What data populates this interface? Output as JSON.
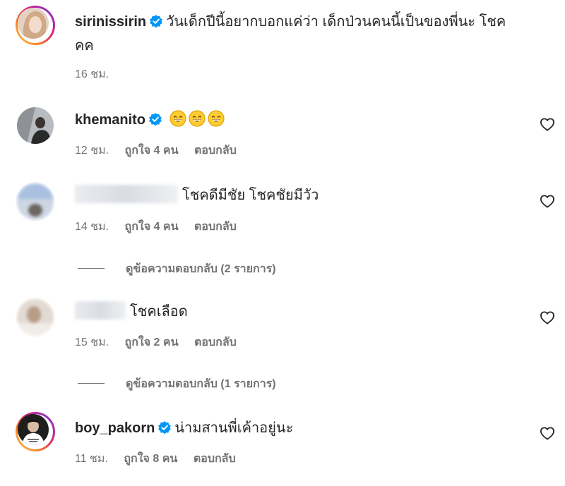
{
  "comments": [
    {
      "username": "sirinissirin",
      "verified": true,
      "text": "วันเด็กปีนี้อยากบอกแค่ว่า เด็กป่วนคนนี้เป็นของพี่นะ โชค",
      "text_cont": "คค",
      "time": "16 ชม."
    },
    {
      "username": "khemanito",
      "verified": true,
      "emojis": [
        "grinning-face-smiling-eyes",
        "grinning-face-smiling-eyes",
        "grinning-face-smiling-eyes"
      ],
      "time": "12 ชม.",
      "likes": "ถูกใจ 4 คน",
      "reply": "ตอบกลับ"
    },
    {
      "username": "",
      "text": "โชคดีมีชัย โชคชัยมีวัว",
      "time": "14 ชม.",
      "likes": "ถูกใจ 4 คน",
      "reply": "ตอบกลับ",
      "view_replies": "ดูข้อความตอบกลับ (2 รายการ)"
    },
    {
      "username": "",
      "text": "โชคเลือด",
      "time": "15 ชม.",
      "likes": "ถูกใจ 2 คน",
      "reply": "ตอบกลับ",
      "view_replies": "ดูข้อความตอบกลับ (1 รายการ)"
    },
    {
      "username": "boy_pakorn",
      "verified": true,
      "text": "น่ามสานพี่เค้าอยู่นะ",
      "time": "11 ชม.",
      "likes": "ถูกใจ 8 คน",
      "reply": "ตอบกลับ"
    }
  ],
  "colors": {
    "text": "#262626",
    "muted": "#737373",
    "verified": "#0095f6",
    "story_ring": "#d62976"
  },
  "icons": {
    "verified": "verified-badge-icon",
    "like": "heart-icon"
  }
}
